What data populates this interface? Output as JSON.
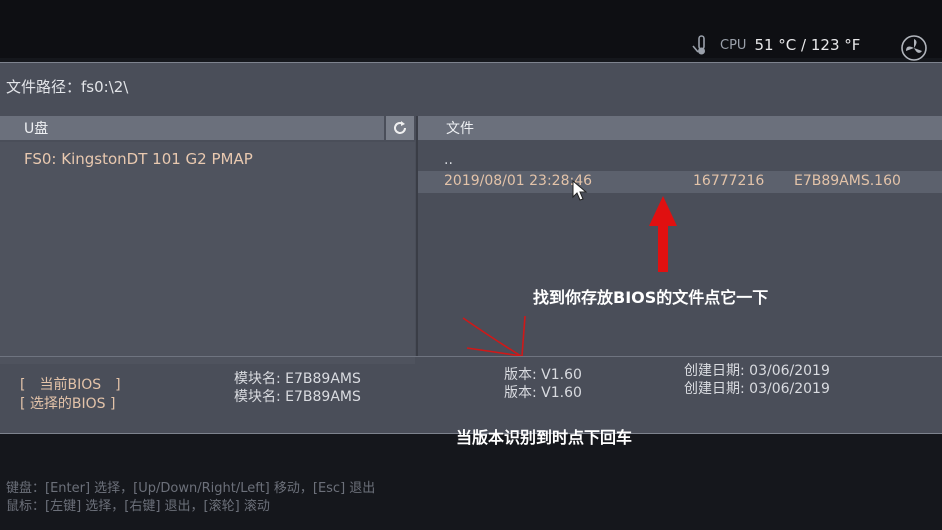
{
  "status": {
    "cpu_label": "CPU",
    "cpu_temp": "51 °C / 123 °F"
  },
  "path": {
    "label": "文件路径：fs0:\\2\\"
  },
  "left_panel": {
    "header": "U盘",
    "drive": "FS0: KingstonDT 101 G2 PMAP"
  },
  "right_panel": {
    "header": "文件",
    "parent": "..",
    "file": {
      "datetime": "2019/08/01 23:28:46",
      "size": "16777216",
      "name": "E7B89AMS.160"
    }
  },
  "annotations": {
    "find_file": "找到你存放BIOS的文件点它一下",
    "press_enter": "当版本识别到时点下回车"
  },
  "bios_info": {
    "current_btn": "[　当前BIOS　]",
    "current_module": "模块名: E7B89AMS",
    "current_version": "版本: V1.60",
    "current_date": "创建日期: 03/06/2019",
    "selected_btn": "[ 选择的BIOS ]",
    "selected_module": "模块名: E7B89AMS",
    "selected_version": "版本: V1.60",
    "selected_date": "创建日期: 03/06/2019"
  },
  "footer": {
    "keyboard": "键盘：[Enter] 选择，[Up/Down/Right/Left] 移动，[Esc] 退出",
    "mouse": "鼠标：[左键] 选择，[右键] 退出，[滚轮] 滚动"
  },
  "colors": {
    "panel": "#4a4e59",
    "header": "#6b707c",
    "highlight_text": "#e3c3a9",
    "arrow": "#e01010"
  }
}
